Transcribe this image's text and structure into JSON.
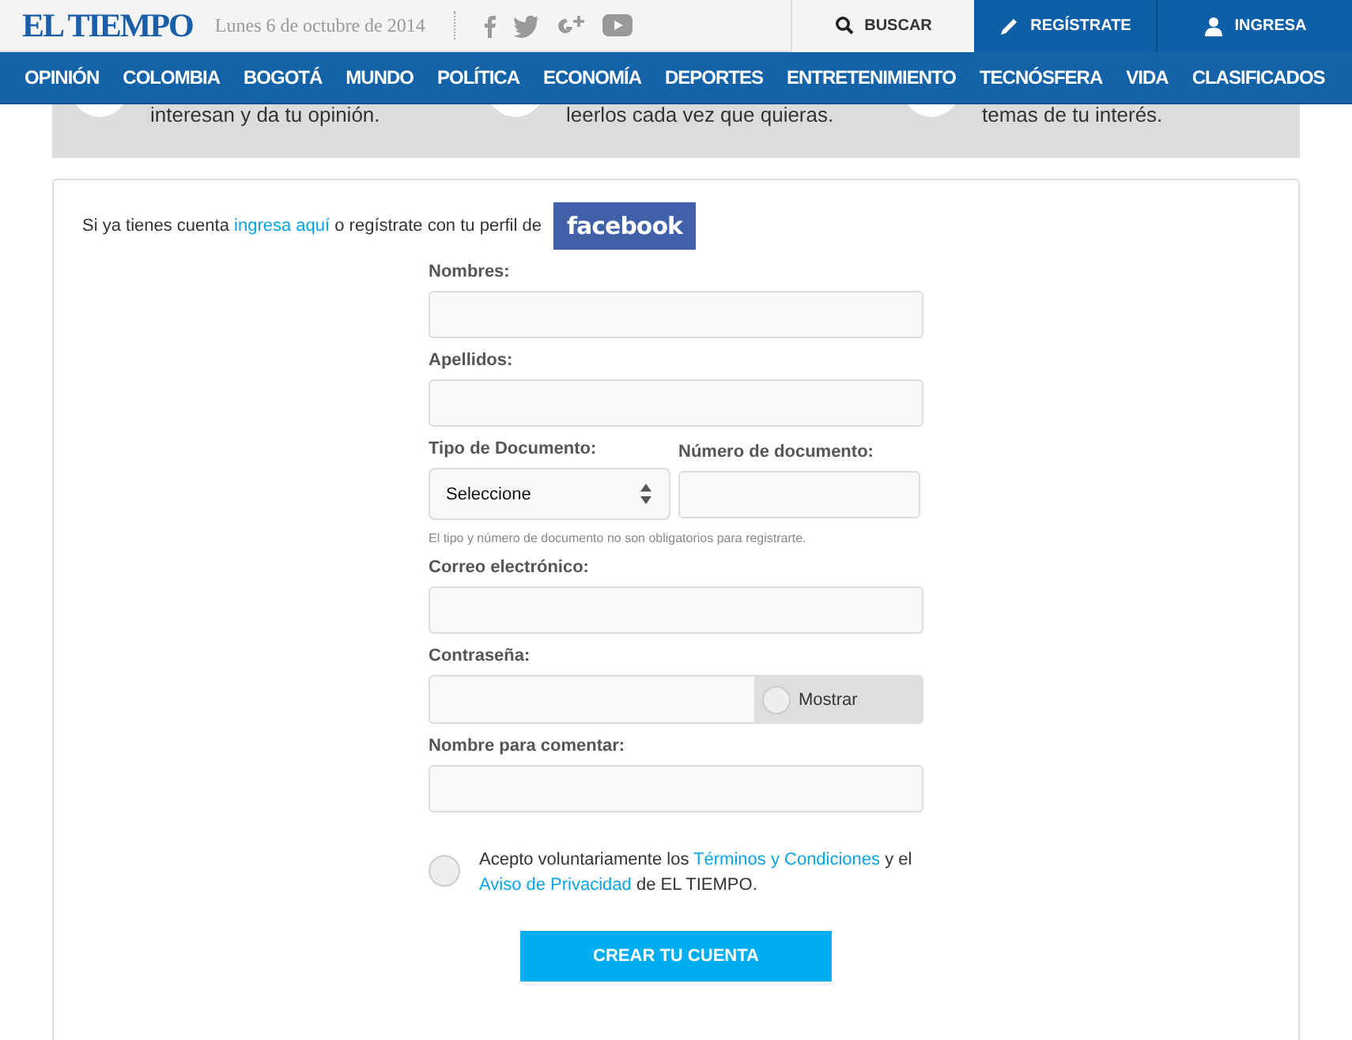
{
  "header": {
    "logo": "EL TIEMPO",
    "date": "Lunes 6 de octubre de 2014",
    "buttons": [
      {
        "kind": "search",
        "label": "BUSCAR"
      },
      {
        "kind": "register",
        "label": "REGÍSTRATE"
      },
      {
        "kind": "login",
        "label": "INGRESA"
      }
    ]
  },
  "nav": [
    "OPINIÓN",
    "COLOMBIA",
    "BOGOTÁ",
    "MUNDO",
    "POLÍTICA",
    "ECONOMÍA",
    "DEPORTES",
    "ENTRETENIMIENTO",
    "TECNÓSFERA",
    "VIDA",
    "CLASIFICADOS"
  ],
  "benefits": [
    "interesan y da tu opinión.",
    "leerlos cada vez que quieras.",
    "temas de tu interés."
  ],
  "intro": [
    {
      "kind": "text",
      "text": "Si ya tienes cuenta "
    },
    {
      "kind": "link",
      "text": "ingresa aquí"
    },
    {
      "kind": "text",
      "text": " o regístrate con tu perfil de"
    }
  ],
  "facebook_button": "facebook",
  "fields": [
    {
      "kind": "text",
      "label": "Nombres:"
    },
    {
      "kind": "text",
      "label": "Apellidos:"
    },
    {
      "kind": "doc",
      "label": "Tipo de Documento:",
      "value": "Seleccione",
      "label2": "Número de documento:",
      "hint": "El tipo y número de documento no son obligatorios para registrarte."
    },
    {
      "kind": "text",
      "label": "Correo electrónico:"
    },
    {
      "kind": "password",
      "label": "Contraseña:",
      "toggle": "Mostrar",
      "checked": false
    },
    {
      "kind": "text",
      "label": "Nombre para comentar:"
    }
  ],
  "terms": {
    "checked": false,
    "parts": [
      {
        "kind": "text",
        "text": "Acepto voluntariamente los "
      },
      {
        "kind": "link",
        "text": "Términos y Condiciones"
      },
      {
        "kind": "text",
        "text": " y el "
      },
      {
        "kind": "link",
        "text": "Aviso de Privacidad"
      },
      {
        "kind": "text",
        "text": " de EL TIEMPO."
      }
    ]
  },
  "submit": "CREAR TU CUENTA"
}
